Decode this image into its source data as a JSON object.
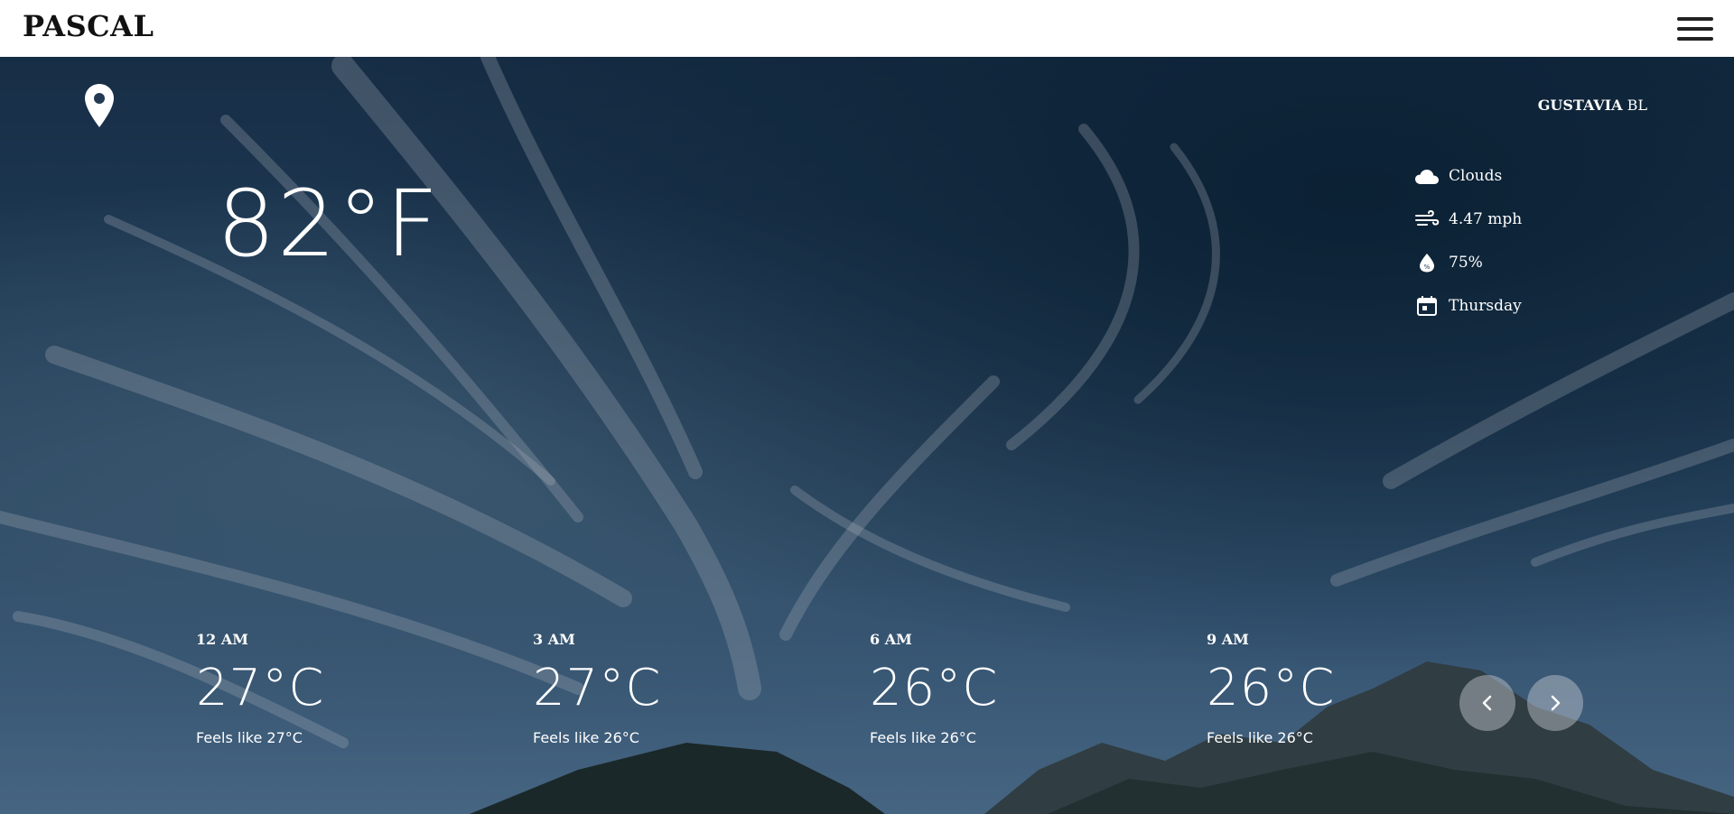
{
  "header": {
    "brand": "PASCAL",
    "menu_icon": "hamburger-menu-icon"
  },
  "location": {
    "icon": "map-pin-icon",
    "city": "GUSTAVIA",
    "country": "BL"
  },
  "current": {
    "temperature": "82°F"
  },
  "stats": {
    "condition": "Clouds",
    "condition_icon": "cloud-icon",
    "wind": "4.47 mph",
    "wind_icon": "wind-icon",
    "humidity": "75%",
    "humidity_icon": "humidity-drop-icon",
    "day": "Thursday",
    "day_icon": "calendar-icon"
  },
  "forecast": [
    {
      "time": "12 AM",
      "temp": "27°C",
      "feels": "Feels like 27°C"
    },
    {
      "time": "3 AM",
      "temp": "27°C",
      "feels": "Feels like 26°C"
    },
    {
      "time": "6 AM",
      "temp": "26°C",
      "feels": "Feels like 26°C"
    },
    {
      "time": "9 AM",
      "temp": "26°C",
      "feels": "Feels like 26°C"
    }
  ],
  "carousel": {
    "prev_icon": "chevron-left-icon",
    "next_icon": "chevron-right-icon"
  }
}
